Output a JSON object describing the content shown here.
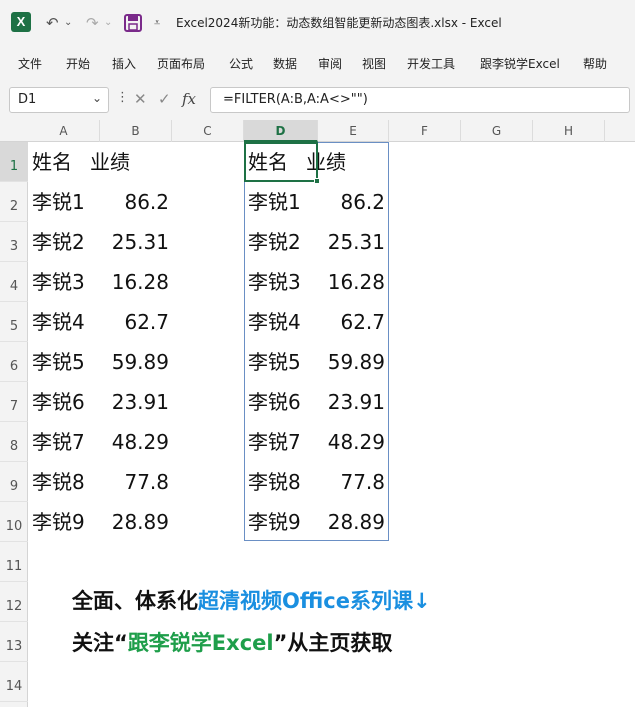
{
  "titlebar": {
    "logo_letter": "X",
    "title": "Excel2024新功能：动态数组智能更新动态图表.xlsx  -  Excel",
    "undo_icon": "undo-icon",
    "redo_icon": "redo-icon",
    "save_icon": "save-icon",
    "customize_icon": "customize-icon"
  },
  "menu": [
    "文件",
    "开始",
    "插入",
    "页面布局",
    "公式",
    "数据",
    "审阅",
    "视图",
    "开发工具",
    "跟李锐学Excel",
    "帮助"
  ],
  "formulabar": {
    "namebox": "D1",
    "fx_symbol": "fx",
    "formula": "=FILTER(A:B,A:A<>\"\")"
  },
  "columns": [
    "A",
    "B",
    "C",
    "D",
    "E",
    "F",
    "G",
    "H"
  ],
  "selected_column": "D",
  "rows": [
    "1",
    "2",
    "3",
    "4",
    "5",
    "6",
    "7",
    "8",
    "9",
    "10",
    "11",
    "12",
    "13",
    "14"
  ],
  "selected_row": "1",
  "source_table": {
    "headers": [
      "姓名",
      "业绩"
    ],
    "rows": [
      [
        "李锐1",
        "86.2"
      ],
      [
        "李锐2",
        "25.31"
      ],
      [
        "李锐3",
        "16.28"
      ],
      [
        "李锐4",
        "62.7"
      ],
      [
        "李锐5",
        "59.89"
      ],
      [
        "李锐6",
        "23.91"
      ],
      [
        "李锐7",
        "48.29"
      ],
      [
        "李锐8",
        "77.8"
      ],
      [
        "李锐9",
        "28.89"
      ]
    ]
  },
  "filtered_table": {
    "headers": [
      "姓名",
      "业绩"
    ],
    "rows": [
      [
        "李锐1",
        "86.2"
      ],
      [
        "李锐2",
        "25.31"
      ],
      [
        "李锐3",
        "16.28"
      ],
      [
        "李锐4",
        "62.7"
      ],
      [
        "李锐5",
        "59.89"
      ],
      [
        "李锐6",
        "23.91"
      ],
      [
        "李锐7",
        "48.29"
      ],
      [
        "李锐8",
        "77.8"
      ],
      [
        "李锐9",
        "28.89"
      ]
    ]
  },
  "banner": {
    "line1_prefix": "全面、体系化",
    "line1_highlight": "超清视频Office系列课↓",
    "line2_prefix": "关注“",
    "line2_highlight": "跟李锐学Excel",
    "line2_suffix": "”从主页获取"
  }
}
